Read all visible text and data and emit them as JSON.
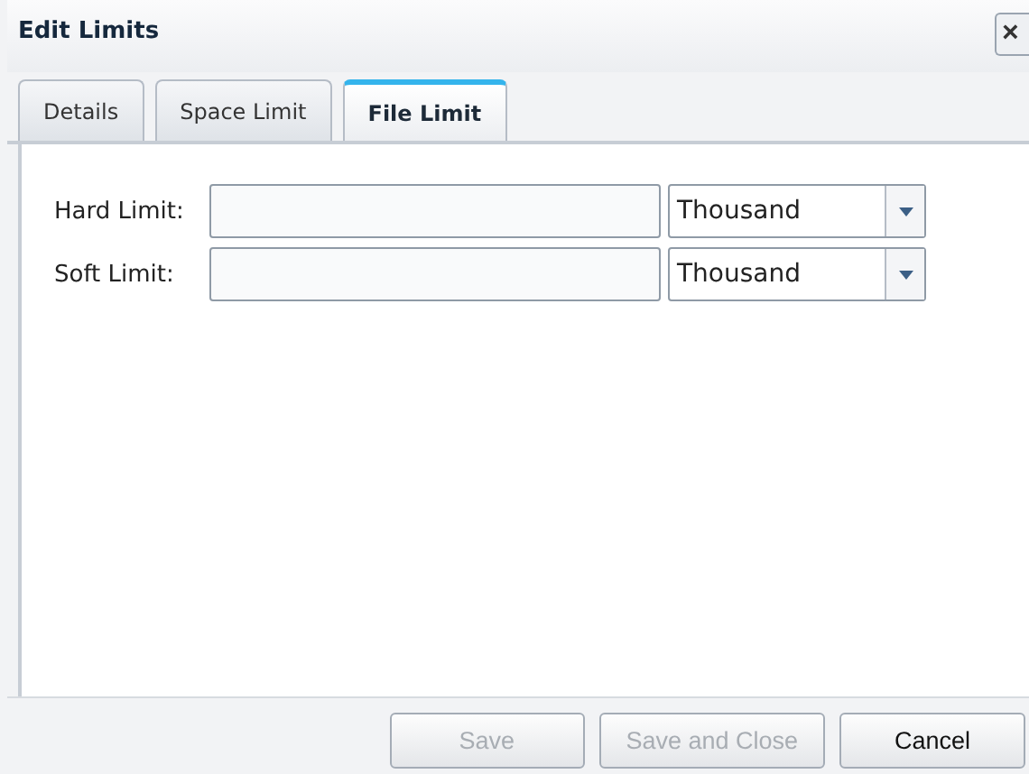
{
  "window": {
    "title": "Edit Limits",
    "close": "×"
  },
  "tabs": [
    {
      "label": "Details",
      "selected": false
    },
    {
      "label": "Space Limit",
      "selected": false
    },
    {
      "label": "File Limit",
      "selected": true
    }
  ],
  "fields": [
    {
      "label": "Hard Limit:",
      "unit": "Thousand"
    },
    {
      "label": "Soft Limit:",
      "unit": "Thousand"
    }
  ],
  "buttons": [
    {
      "label": "Save",
      "disabled": true
    },
    {
      "label": "Save and Close",
      "disabled": true
    },
    {
      "label": "Cancel",
      "disabled": false
    }
  ]
}
